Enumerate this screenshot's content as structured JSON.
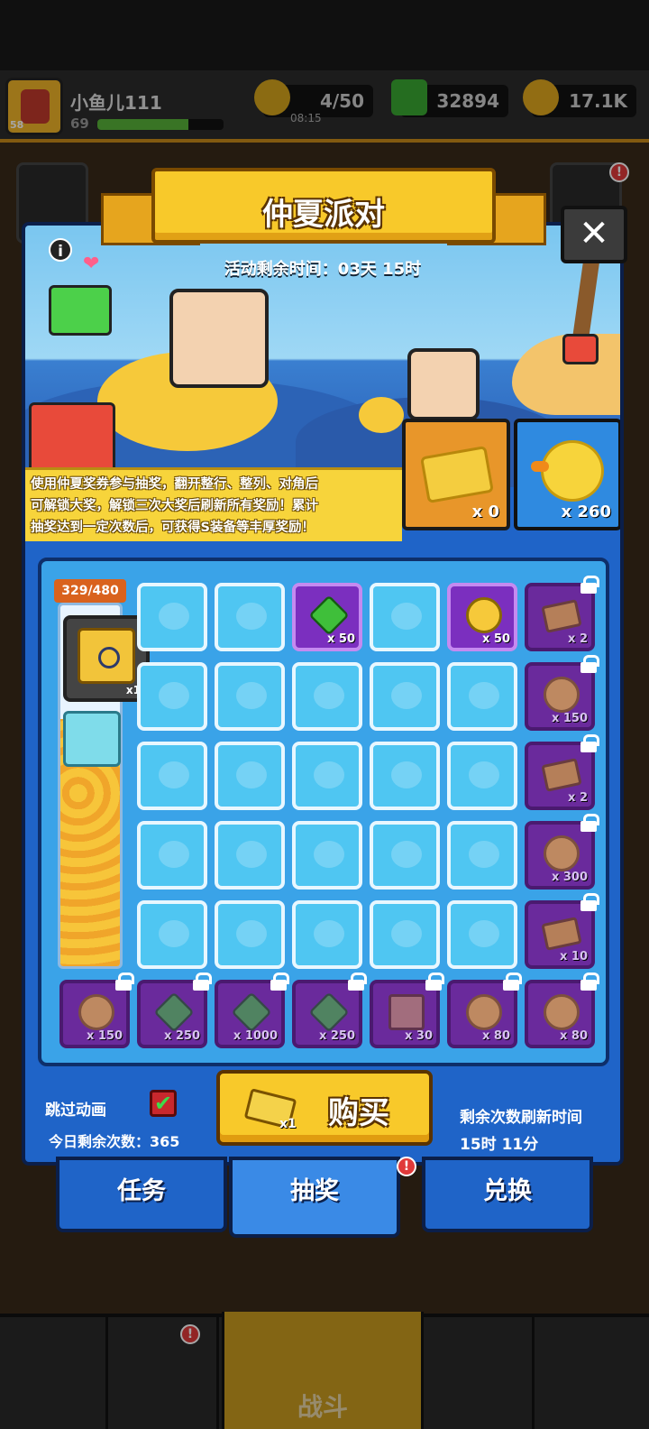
{
  "hud": {
    "player_name": "小鱼儿111",
    "player_level": "69",
    "avatar_level": "58",
    "xp_progress": 0.72,
    "energy": "4/50",
    "energy_timer": "08:15",
    "gems": "32894",
    "gold": "17.1K"
  },
  "dialog": {
    "title": "仲夏派对",
    "countdown": "活动剩余时间：03天 15时",
    "info_glyph": "i",
    "heart_glyph": "❤",
    "close_glyph": "✕",
    "description_lines": [
      "使用仲夏奖券参与抽奖，翻开整行、整列、对角后",
      "可解锁大奖，解锁三次大奖后刷新所有奖励！累计",
      "抽奖达到一定次数后，可获得S装备等丰厚奖励！"
    ],
    "tickets": {
      "count": "x 0"
    },
    "ducks": {
      "count": "x 260"
    }
  },
  "progress": {
    "label": "329/480",
    "fraction": 0.685,
    "chest_qty": "x1"
  },
  "grid": {
    "top_row": [
      {
        "type": "hidden"
      },
      {
        "type": "hidden"
      },
      {
        "type": "revealed",
        "item": "gem",
        "qty": "x 50"
      },
      {
        "type": "hidden"
      },
      {
        "type": "revealed",
        "item": "duck",
        "qty": "x 50"
      }
    ],
    "hidden_rows": 4,
    "right_column": [
      {
        "item": "ticket",
        "qty": "x 2"
      },
      {
        "item": "duck",
        "qty": "x 150"
      },
      {
        "item": "ticket",
        "qty": "x 2"
      },
      {
        "item": "duck",
        "qty": "x 300"
      },
      {
        "item": "ticket",
        "qty": "x 10"
      }
    ],
    "bottom_row": [
      {
        "item": "duck",
        "qty": "x 150"
      },
      {
        "item": "gem",
        "qty": "x 250"
      },
      {
        "item": "gem",
        "qty": "x 1000"
      },
      {
        "item": "gem",
        "qty": "x 250"
      },
      {
        "item": "map",
        "qty": "x 30"
      },
      {
        "item": "duck",
        "qty": "x 80"
      },
      {
        "item": "duck",
        "qty": "x 80"
      }
    ]
  },
  "controls": {
    "skip_animation": "跳过动画",
    "skip_checked_glyph": "✔",
    "remaining_today": "今日剩余次数：365",
    "buy_qty": "x1",
    "buy_label": "购买",
    "refresh_title": "剩余次数刷新时间",
    "refresh_time": "15时 11分"
  },
  "tabs": [
    {
      "label": "任务"
    },
    {
      "label": "抽奖",
      "badge": "!"
    },
    {
      "label": "兑换"
    }
  ],
  "bottom_nav": {
    "battle_label": "战斗",
    "badge": "!"
  },
  "colors": {
    "panel_blue": "#1f64c8",
    "tile_blue": "#4fc6f2",
    "reward_purple": "#7b2fbf",
    "accent_yellow": "#f8c92a"
  }
}
